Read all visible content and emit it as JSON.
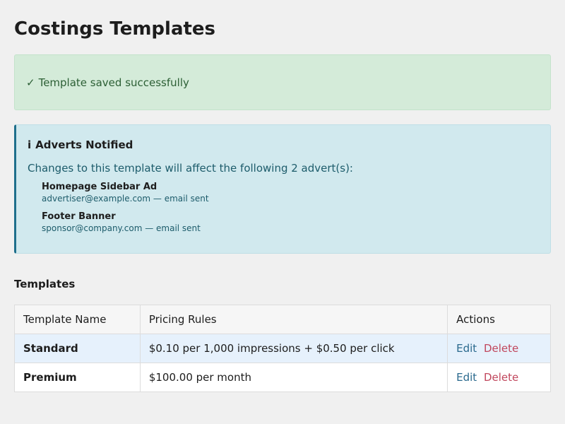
{
  "page": {
    "title": "Costings Templates"
  },
  "success_alert": {
    "icon": "✓",
    "message": "Template saved successfully"
  },
  "info_panel": {
    "icon": "i",
    "heading": "Adverts Notified",
    "message": "Changes to this template will affect the following 2 advert(s):",
    "adverts": [
      {
        "name": "Homepage Sidebar Ad",
        "detail": "advertiser@example.com — email sent"
      },
      {
        "name": "Footer Banner",
        "detail": "sponsor@company.com — email sent"
      }
    ]
  },
  "templates": {
    "section_title": "Templates",
    "columns": [
      "Template Name",
      "Pricing Rules",
      "Actions"
    ],
    "rows": [
      {
        "name": "Standard",
        "rules": "$0.10 per 1,000 impressions + $0.50 per click",
        "edit_label": "Edit",
        "delete_label": "Delete"
      },
      {
        "name": "Premium",
        "rules": "$100.00 per month",
        "edit_label": "Edit",
        "delete_label": "Delete"
      }
    ]
  },
  "colors": {
    "success_bg": "#d4ebd9",
    "info_bg": "#d1e9ee",
    "info_accent": "#1f6f8c",
    "link_edit": "#2b6a8e",
    "link_delete": "#c1475d",
    "row_highlight": "#e6f1fc"
  }
}
